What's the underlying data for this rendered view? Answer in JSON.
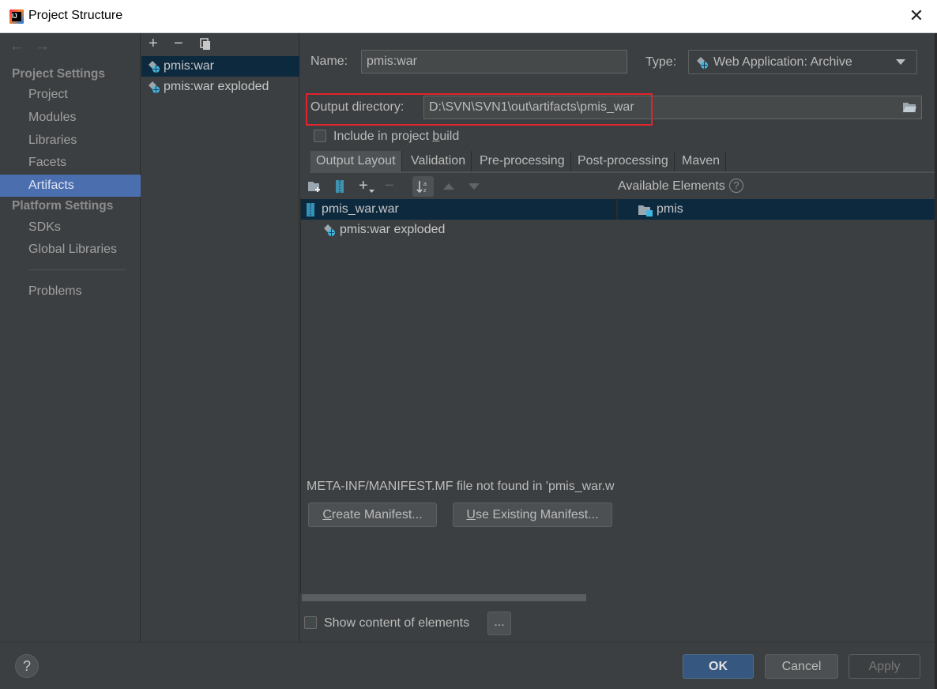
{
  "window": {
    "title": "Project Structure",
    "close_glyph": "✕"
  },
  "nav": {
    "back_glyph": "←",
    "forward_glyph": "→",
    "project_settings_header": "Project Settings",
    "project_items": [
      "Project",
      "Modules",
      "Libraries",
      "Facets",
      "Artifacts"
    ],
    "selected": "Artifacts",
    "platform_settings_header": "Platform Settings",
    "platform_items": [
      "SDKs",
      "Global Libraries"
    ],
    "problems": "Problems"
  },
  "artifacts_toolbar": {
    "add": "+",
    "remove": "−"
  },
  "artifacts": [
    {
      "name": "pmis:war",
      "selected": true
    },
    {
      "name": "pmis:war exploded",
      "selected": false
    }
  ],
  "form": {
    "name_label": "Name:",
    "name_value": "pmis:war",
    "type_label": "Type:",
    "type_value": "Web Application: Archive",
    "output_label": "Output directory:",
    "output_value": "D:\\SVN\\SVN1\\out\\artifacts\\pmis_war",
    "include_label_pre": "Include in project ",
    "include_label_mnemonic": "b",
    "include_label_post": "uild",
    "include_checked": false
  },
  "tabs": [
    "Output Layout",
    "Validation",
    "Pre-processing",
    "Post-processing",
    "Maven"
  ],
  "selected_tab": "Output Layout",
  "layout_toolbar": {
    "add": "+",
    "remove": "−"
  },
  "available_elements": {
    "title": "Available Elements",
    "help": "?",
    "items": [
      "pmis"
    ]
  },
  "output_tree": [
    {
      "name": "pmis_war.war",
      "level": 0,
      "selected": true
    },
    {
      "name": "pmis:war exploded",
      "level": 1,
      "selected": false
    }
  ],
  "manifest": {
    "message": "META-INF/MANIFEST.MF file not found in 'pmis_war.w",
    "create_mnemonic": "C",
    "create_rest": "reate Manifest...",
    "use_mnemonic": "U",
    "use_rest": "se Existing Manifest..."
  },
  "show_content": {
    "label": "Show content of elements",
    "checked": false,
    "ellipsis": "..."
  },
  "footer": {
    "help": "?",
    "ok": "OK",
    "cancel": "Cancel",
    "apply": "Apply"
  },
  "colors": {
    "background": "#3c3f41",
    "selection": "#4b6eaf",
    "tree_selection": "#0d293e",
    "highlight_box": "#e0242b",
    "primary_button": "#365880"
  }
}
